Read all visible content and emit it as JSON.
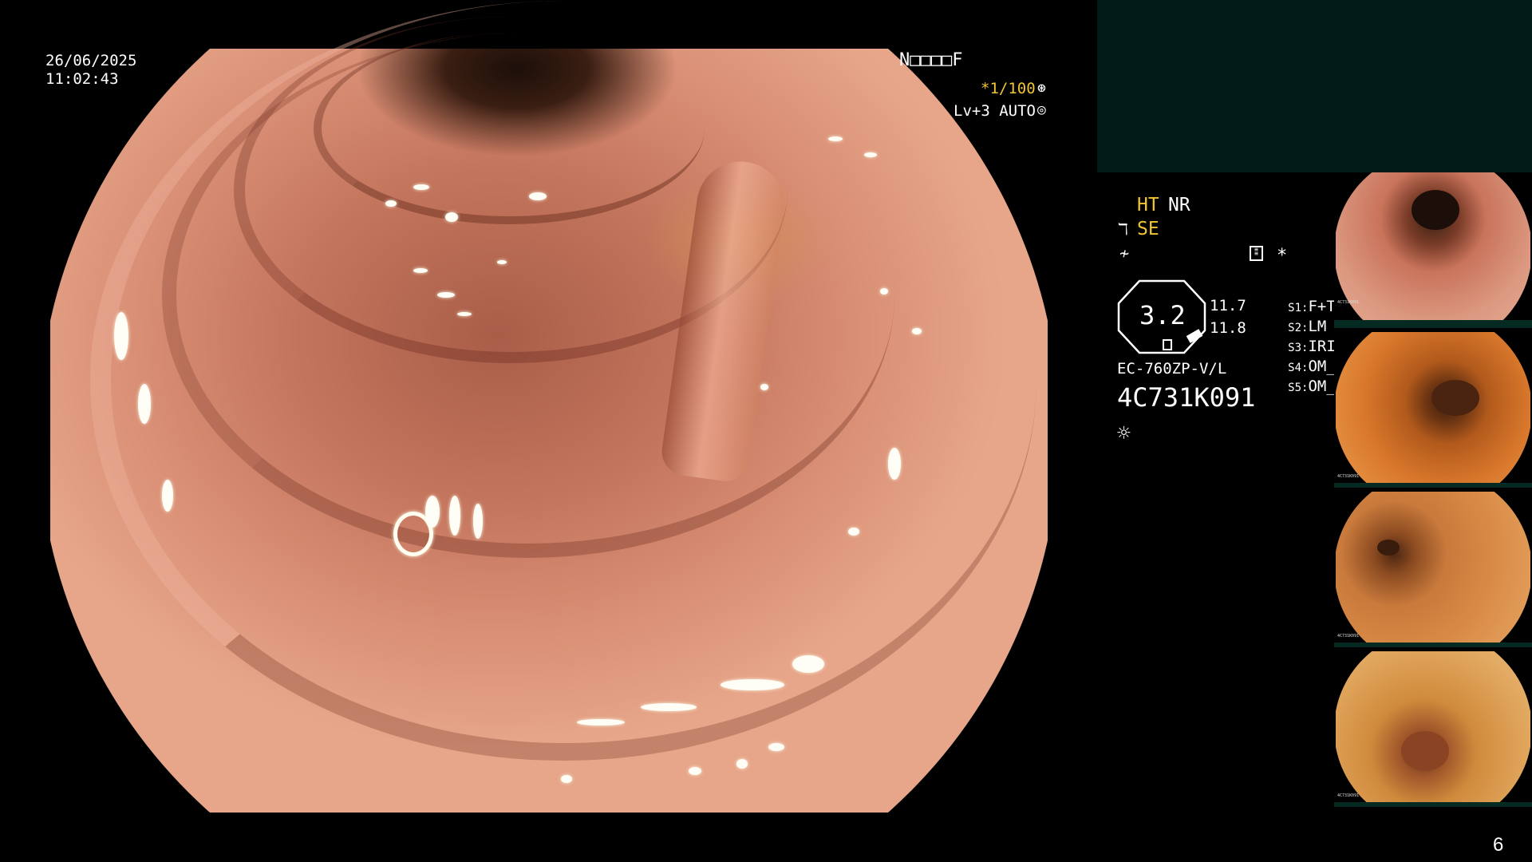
{
  "overlay": {
    "date": "26/06/2025",
    "time": "11:02:43",
    "top_code": "N□□□□F",
    "shutter": "*1/100",
    "shutter_icon": "gear-circle-icon",
    "light_level": "Lv+3 AUTO",
    "light_icon": "concentric-circle-icon"
  },
  "settings": {
    "ht": "HT",
    "nr": "NR",
    "se": "SE",
    "se_icon": "structure-enhance-icon",
    "freeze_icon": "freeze-icon",
    "capture_icon": "memory-card-icon",
    "star": "*",
    "zoom_value": "3.2",
    "zoom_top": "11.7",
    "zoom_bottom": "11.8",
    "scope_model": "EC-760ZP-V/L",
    "serial": "4C731K091",
    "light_icon": "sun-icon"
  },
  "switches": [
    {
      "key": "S1:",
      "value": "F+T"
    },
    {
      "key": "S2:",
      "value": "LM"
    },
    {
      "key": "S3:",
      "value": "IRIS"
    },
    {
      "key": "S4:",
      "value": "OM_DW"
    },
    {
      "key": "S5:",
      "value": "OM_UP"
    }
  ],
  "thumbnails": [
    {
      "name": "thumbnail-1",
      "caption": "4C731K091",
      "tone": "#d27a62"
    },
    {
      "name": "thumbnail-2",
      "caption": "4C731K091",
      "tone": "#d9782c"
    },
    {
      "name": "thumbnail-3",
      "caption": "4C731K091",
      "tone": "#d88a45"
    },
    {
      "name": "thumbnail-4",
      "caption": "4C731K091",
      "tone": "#d08a3c"
    }
  ],
  "page_number": "6",
  "colors": {
    "overlay_text": "#ffffff",
    "accent_yellow": "#f2c531",
    "top_panel": "#021b17",
    "thumb_bar": "#052a22"
  }
}
